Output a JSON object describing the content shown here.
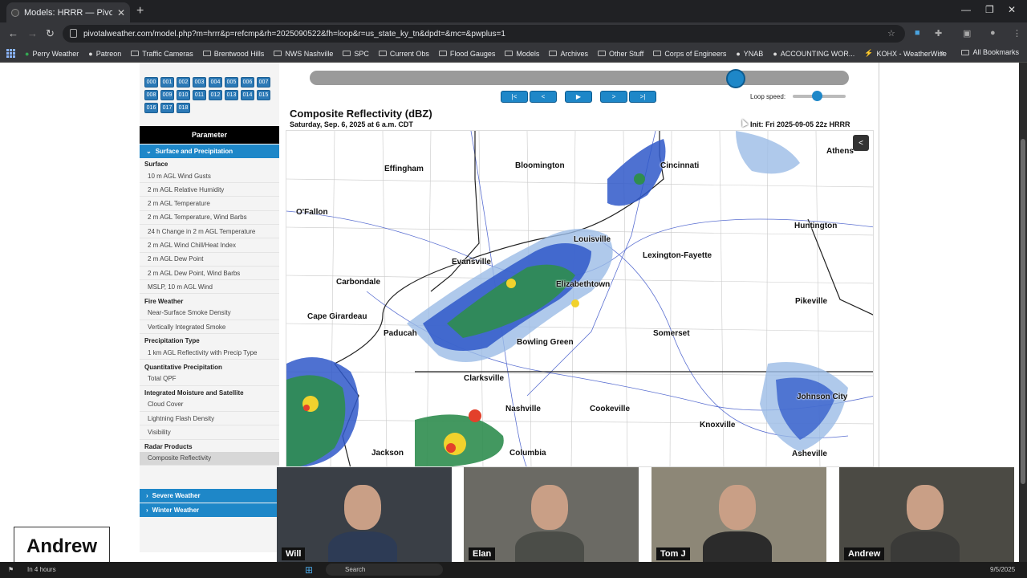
{
  "browser": {
    "tab_title": "Models: HRRR — Pivotal Weath",
    "new_tab": "+",
    "url": "pivotalweather.com/model.php?m=hrrr&p=refcmp&rh=2025090522&fh=loop&r=us_state_ky_tn&dpdt=&mc=&pwplus=1",
    "window_controls": [
      "—",
      "❐",
      "✕"
    ],
    "bookmarks": [
      {
        "label": "Perry Weather",
        "icon": "pin-icon"
      },
      {
        "label": "Patreon",
        "icon": "patreon-icon"
      },
      {
        "label": "Traffic Cameras",
        "icon": "folder-icon"
      },
      {
        "label": "Brentwood Hills",
        "icon": "folder-icon"
      },
      {
        "label": "NWS Nashville",
        "icon": "folder-icon"
      },
      {
        "label": "SPC",
        "icon": "folder-icon"
      },
      {
        "label": "Current Obs",
        "icon": "folder-icon"
      },
      {
        "label": "Flood Gauges",
        "icon": "folder-icon"
      },
      {
        "label": "Models",
        "icon": "folder-icon"
      },
      {
        "label": "Archives",
        "icon": "folder-icon"
      },
      {
        "label": "Other Stuff",
        "icon": "folder-icon"
      },
      {
        "label": "Corps of Engineers",
        "icon": "folder-icon"
      },
      {
        "label": "YNAB",
        "icon": "ynab-icon"
      },
      {
        "label": "ACCOUNTING WOR...",
        "icon": "sheet-icon"
      },
      {
        "label": "KOHX - WeatherWise",
        "icon": "bolt-icon"
      }
    ],
    "more_bookmarks": "»",
    "all_bookmarks": "All Bookmarks"
  },
  "forecast_hours": [
    "000",
    "001",
    "002",
    "003",
    "004",
    "005",
    "006",
    "007",
    "008",
    "009",
    "010",
    "011",
    "012",
    "013",
    "014",
    "015",
    "016",
    "017",
    "018"
  ],
  "sidebar": {
    "header": "Parameter",
    "open_category": "Surface and Precipitation",
    "groups": [
      {
        "title": "Surface",
        "items": [
          "10 m AGL Wind Gusts",
          "2 m AGL Relative Humidity",
          "2 m AGL Temperature",
          "2 m AGL Temperature, Wind Barbs",
          "24 h Change in 2 m AGL Temperature",
          "2 m AGL Wind Chill/Heat Index",
          "2 m AGL Dew Point",
          "2 m AGL Dew Point, Wind Barbs",
          "MSLP, 10 m AGL Wind"
        ]
      },
      {
        "title": "Fire Weather",
        "items": [
          "Near-Surface Smoke Density",
          "Vertically Integrated Smoke"
        ]
      },
      {
        "title": "Precipitation Type",
        "items": [
          "1 km AGL Reflectivity with Precip Type"
        ]
      },
      {
        "title": "Quantitative Precipitation",
        "items": [
          "Total QPF"
        ]
      },
      {
        "title": "Integrated Moisture and Satellite",
        "items": [
          "Cloud Cover",
          "Lightning Flash Density",
          "Visibility"
        ]
      },
      {
        "title": "Radar Products",
        "items": [
          "Composite Reflectivity"
        ]
      }
    ],
    "collapsed_categories": [
      "Severe Weather",
      "Winter Weather"
    ]
  },
  "controls": {
    "first": "|<",
    "prev": "<",
    "play": "▶",
    "next": ">",
    "last": ">|",
    "loop_speed_label": "Loop speed:",
    "timeline_position": 0.79,
    "loop_speed": 0.45
  },
  "map": {
    "title": "Composite Reflectivity (dBZ)",
    "valid": "Saturday, Sep. 6, 2025 at 6 a.m. CDT",
    "init": "Init: Fri 2025-09-05 22z HRRR",
    "cities": [
      "Effingham",
      "Bloomington",
      "Cincinnati",
      "Athens",
      "O'Fallon",
      "Huntington",
      "Louisville",
      "Evansville",
      "Lexington-Fayette",
      "Carbondale",
      "Elizabethtown",
      "Pikeville",
      "Cape Girardeau",
      "Paducah",
      "Somerset",
      "Bowling Green",
      "Clarksville",
      "Johnson City",
      "Nashville",
      "Cookeville",
      "Knoxville",
      "Jackson",
      "Columbia",
      "Asheville"
    ]
  },
  "video": {
    "participants": [
      "Will",
      "Elan",
      "Tom J",
      "Andrew"
    ],
    "speaker": "Andrew"
  },
  "taskbar": {
    "left_text": "In 4 hours",
    "search": "Search",
    "date": "9/5/2025"
  },
  "colors": {
    "accent": "#1e87c8",
    "radar_light_blue": "#9bbbe6",
    "radar_blue": "#2f58c9",
    "radar_green": "#2f8d4f",
    "radar_yellow": "#f1d22d",
    "radar_red": "#e3402b"
  }
}
